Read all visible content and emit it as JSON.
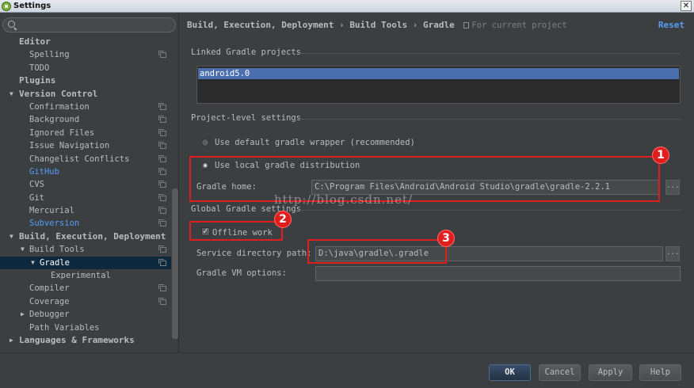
{
  "window": {
    "title": "Settings",
    "close_glyph": "✕"
  },
  "search": {
    "value": "",
    "placeholder": ""
  },
  "sidebar": {
    "items": [
      {
        "label": "Editor",
        "indent": 0,
        "bold": true,
        "arrow": ""
      },
      {
        "label": "Spelling",
        "indent": 2,
        "copy": true
      },
      {
        "label": "TODO",
        "indent": 2
      },
      {
        "label": "Plugins",
        "indent": 0,
        "bold": true
      },
      {
        "label": "Version Control",
        "indent": 0,
        "bold": true,
        "arrow": "▼"
      },
      {
        "label": "Confirmation",
        "indent": 2,
        "copy": true
      },
      {
        "label": "Background",
        "indent": 2,
        "copy": true
      },
      {
        "label": "Ignored Files",
        "indent": 2,
        "copy": true
      },
      {
        "label": "Issue Navigation",
        "indent": 2,
        "copy": true
      },
      {
        "label": "Changelist Conflicts",
        "indent": 2,
        "copy": true
      },
      {
        "label": "GitHub",
        "indent": 2,
        "copy": true,
        "link": true
      },
      {
        "label": "CVS",
        "indent": 2,
        "copy": true
      },
      {
        "label": "Git",
        "indent": 2,
        "copy": true
      },
      {
        "label": "Mercurial",
        "indent": 2,
        "copy": true
      },
      {
        "label": "Subversion",
        "indent": 2,
        "copy": true,
        "link": true
      },
      {
        "label": "Build, Execution, Deployment",
        "indent": 0,
        "bold": true,
        "arrow": "▼"
      },
      {
        "label": "Build Tools",
        "indent": 2,
        "copy": true,
        "arrow": "▼"
      },
      {
        "label": "Gradle",
        "indent": 3,
        "copy": true,
        "arrow": "▼",
        "selected": true
      },
      {
        "label": "Experimental",
        "indent": 4
      },
      {
        "label": "Compiler",
        "indent": 2,
        "copy": true
      },
      {
        "label": "Coverage",
        "indent": 2,
        "copy": true
      },
      {
        "label": "Debugger",
        "indent": 2,
        "arrow": "▶"
      },
      {
        "label": "Path Variables",
        "indent": 2
      },
      {
        "label": "Languages & Frameworks",
        "indent": 0,
        "bold": true,
        "arrow": "▶"
      }
    ]
  },
  "breadcrumb": {
    "part1": "Build, Execution, Deployment",
    "sep1": "›",
    "part2": "Build Tools",
    "sep2": "›",
    "part3": "Gradle",
    "scope": "For current project"
  },
  "reset_label": "Reset",
  "linked": {
    "title": "Linked Gradle projects",
    "selected_project": "android5.0"
  },
  "project_level": {
    "title": "Project-level settings",
    "option_wrapper": "Use default gradle wrapper (recommended)",
    "option_local": "Use local gradle distribution",
    "gradle_home_label": "Gradle home:",
    "gradle_home_value": "C:\\Program Files\\Android\\Android Studio\\gradle\\gradle-2.2.1"
  },
  "global": {
    "title": "Global Gradle settings",
    "offline_label": "Offline work",
    "offline_checked": true,
    "service_dir_label": "Service directory path:",
    "service_dir_value": "D:\\java\\gradle\\.gradle",
    "vm_options_label": "Gradle VM options:",
    "vm_options_value": ""
  },
  "browse_glyph": "...",
  "check_glyph": "✓",
  "annotations": {
    "badge1": "1",
    "badge2": "2",
    "badge3": "3",
    "accent_color": "#e11e1e"
  },
  "watermark": "http://blog.csdn.net/",
  "footer": {
    "ok": "OK",
    "cancel": "Cancel",
    "apply": "Apply",
    "help": "Help"
  },
  "colors": {
    "background": "#3c3f41",
    "selection": "#0d293e",
    "link": "#589df6",
    "list_selection": "#4b6eaf"
  }
}
